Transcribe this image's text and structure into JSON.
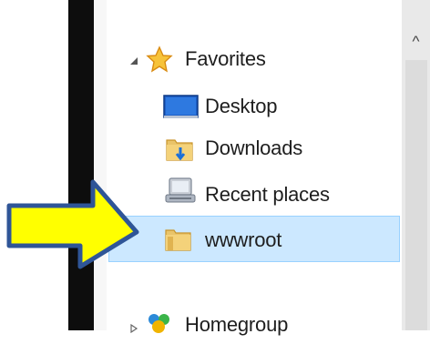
{
  "nav_pane": {
    "favorites": {
      "label": "Favorites",
      "icon": "star-icon",
      "expanded": true
    },
    "items": [
      {
        "label": "Desktop",
        "icon": "desktop-icon"
      },
      {
        "label": "Downloads",
        "icon": "downloads-folder-icon"
      },
      {
        "label": "Recent places",
        "icon": "recent-places-icon"
      },
      {
        "label": "wwwroot",
        "icon": "folder-icon",
        "selected": true
      }
    ],
    "homegroup": {
      "label": "Homegroup",
      "icon": "homegroup-icon",
      "expanded": false
    }
  },
  "scrollbar": {
    "up_glyph": "^"
  },
  "pointer": {
    "icon": "yellow-arrow-icon",
    "fill": "#ffff00",
    "stroke": "#2f5597"
  },
  "colors": {
    "selection_bg": "#cce8ff",
    "selection_border": "#99d1ff",
    "window_edge": "#0d0d0d"
  }
}
